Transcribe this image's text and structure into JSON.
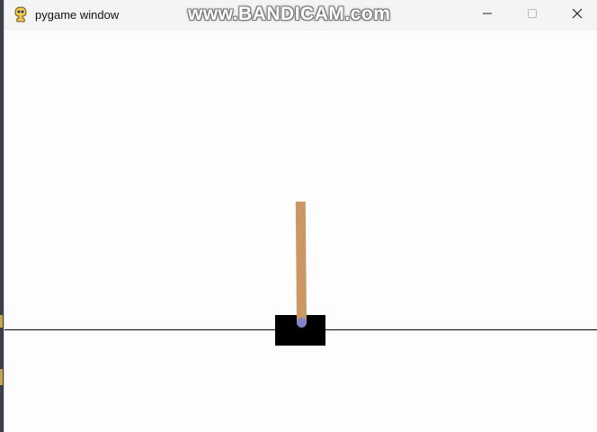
{
  "window": {
    "title": "pygame window",
    "watermark": "www.BANDICAM.com",
    "app_icon": "pygame-snake-icon",
    "controls": {
      "minimize_icon": "minimize-icon",
      "maximize_icon": "maximize-icon",
      "close_icon": "close-icon"
    }
  },
  "scene": {
    "environment": "CartPole",
    "background_color": "#fdfdfd",
    "track_color": "#000000",
    "cart_color": "#000000",
    "pole_color": "#ca9865",
    "axle_color": "#8184cb"
  }
}
